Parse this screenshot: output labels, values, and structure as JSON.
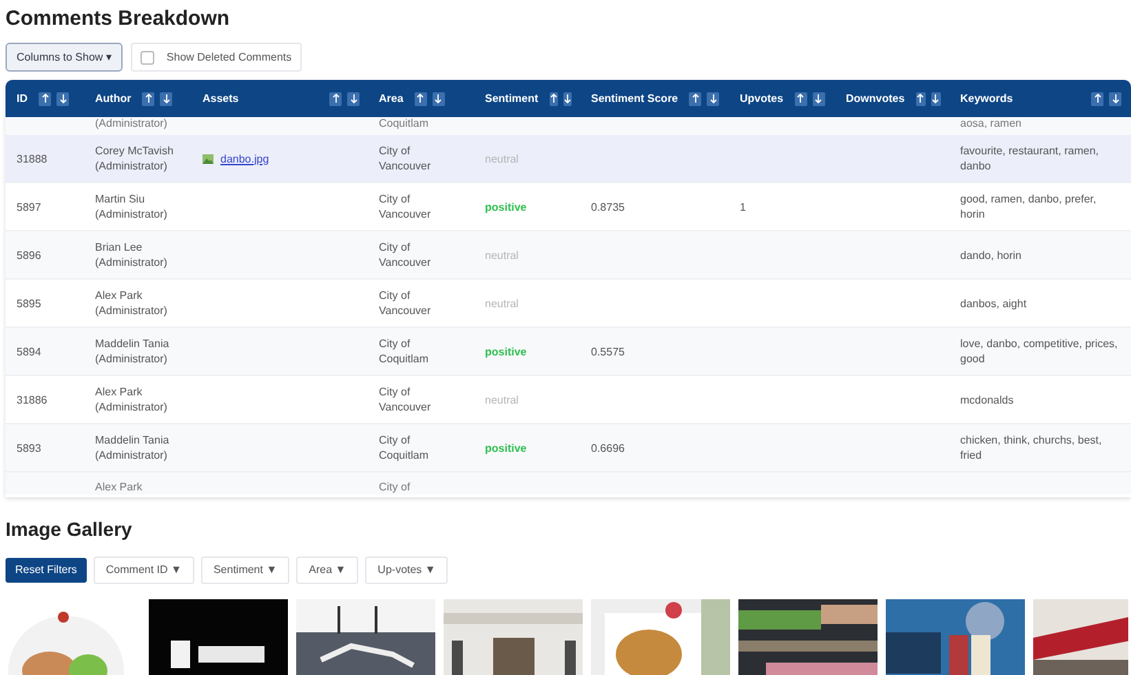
{
  "title": "Comments Breakdown",
  "columns_button": "Columns to Show ▾",
  "show_deleted": {
    "label": "Show Deleted Comments",
    "checked": false
  },
  "table": {
    "columns": [
      "ID",
      "Author",
      "Assets",
      "Area",
      "Sentiment",
      "Sentiment Score",
      "Upvotes",
      "Downvotes",
      "Keywords"
    ],
    "top_partial_row": {
      "author": "(Administrator)",
      "area": "Coquitlam",
      "keywords": "aosa, ramen"
    },
    "rows": [
      {
        "id": "31888",
        "author": "Corey McTavish",
        "role": "(Administrator)",
        "asset": "danbo.jpg",
        "area": "City of Vancouver",
        "sentiment": "neutral",
        "kind": "neutral",
        "score": "",
        "upvotes": "",
        "downvotes": "",
        "keywords": "favourite, restaurant, ramen, danbo",
        "selected": true
      },
      {
        "id": "5897",
        "author": "Martin Siu",
        "role": "(Administrator)",
        "asset": "",
        "area": "City of Vancouver",
        "sentiment": "positive",
        "kind": "positive",
        "score": "0.8735",
        "upvotes": "1",
        "downvotes": "",
        "keywords": "good, ramen, danbo, prefer, horin",
        "selected": false
      },
      {
        "id": "5896",
        "author": "Brian Lee",
        "role": "(Administrator)",
        "asset": "",
        "area": "City of Vancouver",
        "sentiment": "neutral",
        "kind": "neutral",
        "score": "",
        "upvotes": "",
        "downvotes": "",
        "keywords": "dando, horin",
        "selected": false
      },
      {
        "id": "5895",
        "author": "Alex Park",
        "role": "(Administrator)",
        "asset": "",
        "area": "City of Vancouver",
        "sentiment": "neutral",
        "kind": "neutral",
        "score": "",
        "upvotes": "",
        "downvotes": "",
        "keywords": "danbos, aight",
        "selected": false
      },
      {
        "id": "5894",
        "author": "Maddelin Tania",
        "role": "(Administrator)",
        "asset": "",
        "area": "City of Coquitlam",
        "sentiment": "positive",
        "kind": "positive",
        "score": "0.5575",
        "upvotes": "",
        "downvotes": "",
        "keywords": "love, danbo, competitive, prices, good",
        "selected": false
      },
      {
        "id": "31886",
        "author": "Alex Park",
        "role": "(Administrator)",
        "asset": "",
        "area": "City of Vancouver",
        "sentiment": "neutral",
        "kind": "neutral",
        "score": "",
        "upvotes": "",
        "downvotes": "",
        "keywords": "mcdonalds",
        "selected": false
      },
      {
        "id": "5893",
        "author": "Maddelin Tania",
        "role": "(Administrator)",
        "asset": "",
        "area": "City of Coquitlam",
        "sentiment": "positive",
        "kind": "positive",
        "score": "0.6696",
        "upvotes": "",
        "downvotes": "",
        "keywords": "chicken, think, churchs, best, fried",
        "selected": false
      }
    ],
    "bottom_partial_row": {
      "author": "Alex Park",
      "area": "City of"
    }
  },
  "gallery": {
    "title": "Image Gallery",
    "reset_button": "Reset Filters",
    "filters": [
      "Comment ID ▼",
      "Sentiment ▼",
      "Area ▼",
      "Up-votes ▼"
    ]
  }
}
